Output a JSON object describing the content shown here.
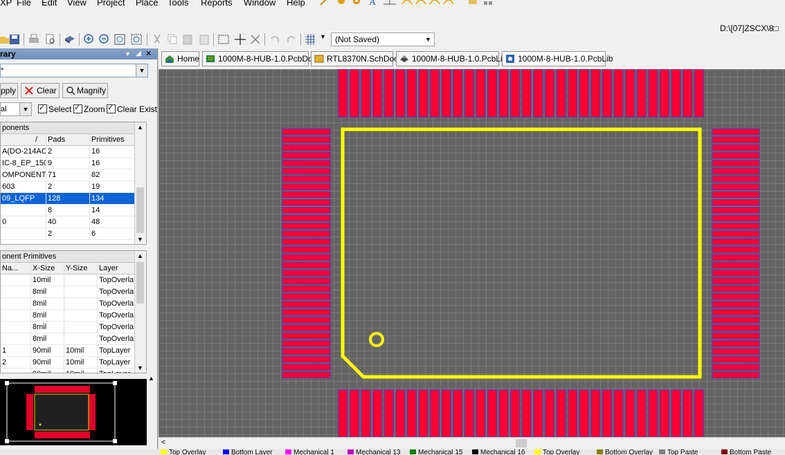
{
  "menu": [
    "XP",
    "File",
    "Edit",
    "View",
    "Project",
    "Place",
    "Tools",
    "Reports",
    "Window",
    "Help"
  ],
  "path": "D:\\[07]ZSCX\\8□",
  "view_config": "(Not Saved)",
  "panel": {
    "title": "rary",
    "filter_value": "*",
    "buttons": {
      "apply": "pply",
      "clear": "Clear",
      "magnify": "Magnify"
    },
    "mode": "al",
    "checks": {
      "select": "Select",
      "zoom": "Zoom",
      "clear_existing": "Clear Existir"
    }
  },
  "components": {
    "section": "ponents",
    "columns": [
      "",
      "Pads",
      "Primitives"
    ],
    "rows": [
      {
        "name": "A(DO-214AC)",
        "pads": "2",
        "primitives": "16"
      },
      {
        "name": "IC-8_EP_150M",
        "pads": "9",
        "primitives": "16"
      },
      {
        "name": "OMPONENT_",
        "pads": "71",
        "primitives": "82"
      },
      {
        "name": "603",
        "pads": "2",
        "primitives": "19"
      },
      {
        "name": "09_LQFP",
        "pads": "128",
        "primitives": "134"
      },
      {
        "name": "",
        "pads": "8",
        "primitives": "14"
      },
      {
        "name": "0",
        "pads": "40",
        "primitives": "48"
      },
      {
        "name": "",
        "pads": "2",
        "primitives": "6"
      }
    ],
    "selected_index": 4
  },
  "primitives": {
    "section": "onent Primitives",
    "columns": [
      "Na...",
      "X-Size",
      "Y-Size",
      "Layer"
    ],
    "rows": [
      {
        "name": "",
        "x": "10mil",
        "y": "",
        "layer": "TopOverla"
      },
      {
        "name": "",
        "x": "8mil",
        "y": "",
        "layer": "TopOverla"
      },
      {
        "name": "",
        "x": "8mil",
        "y": "",
        "layer": "TopOverla"
      },
      {
        "name": "",
        "x": "8mil",
        "y": "",
        "layer": "TopOverla"
      },
      {
        "name": "",
        "x": "8mil",
        "y": "",
        "layer": "TopOverla"
      },
      {
        "name": "",
        "x": "8mil",
        "y": "",
        "layer": "TopOverla"
      },
      {
        "name": "1",
        "x": "90mil",
        "y": "10mil",
        "layer": "TopLayer"
      },
      {
        "name": "2",
        "x": "90mil",
        "y": "10mil",
        "layer": "TopLayer"
      },
      {
        "name": "",
        "x": "90mil",
        "y": "10mil",
        "layer": "TopLayer"
      }
    ]
  },
  "tabs": [
    {
      "label": "Home",
      "icon": "home-icon"
    },
    {
      "label": "1000M-8-HUB-1.0.PcbDoc",
      "icon": "pcb-doc-icon"
    },
    {
      "label": "RTL8370N.SchDoc",
      "icon": "sch-doc-icon"
    },
    {
      "label": "1000M-8-HUB-1.0.PcbLib",
      "icon": "pcb-lib-icon"
    },
    {
      "label": "1000M-8-HUB-1.0.PcbLib",
      "icon": "pcb-lib-icon"
    }
  ],
  "layers": [
    {
      "label": "Top Overlay",
      "color": "#ffff00"
    },
    {
      "label": "Bottom Layer",
      "color": "#0000ff"
    },
    {
      "label": "Mechanical 1",
      "color": "#ff00ff"
    },
    {
      "label": "Mechanical 13",
      "color": "#c000c0"
    },
    {
      "label": "Mechanical 15",
      "color": "#008000"
    },
    {
      "label": "Mechanical 16",
      "color": "#000000"
    },
    {
      "label": "Top Overlay",
      "color": "#ffff00"
    },
    {
      "label": "Bottom Overlay",
      "color": "#808000"
    },
    {
      "label": "Top Paste",
      "color": "#808080"
    },
    {
      "label": "Bottom Paste",
      "color": "#800000"
    }
  ],
  "footprint": {
    "pads_per_side": 32,
    "pad_color": "#ff0033",
    "pad_border": "#7a2a9a",
    "outline_color": "#ffff00"
  }
}
